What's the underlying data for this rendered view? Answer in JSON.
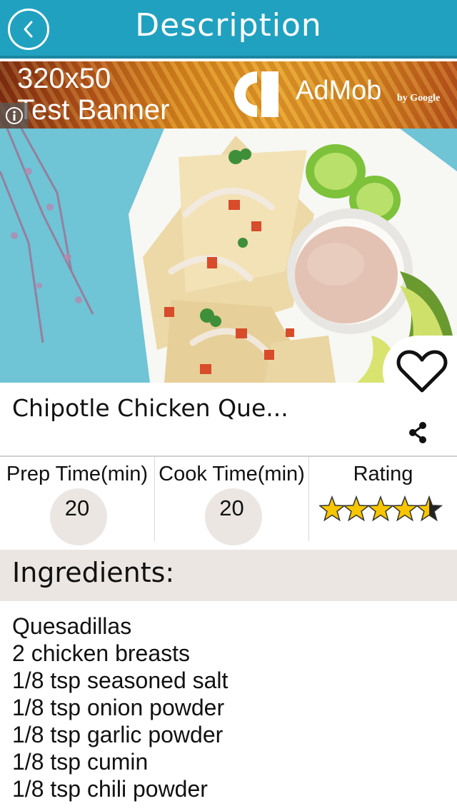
{
  "header": {
    "title": "Description",
    "back_icon": "chevron-left-icon",
    "background_color": "#21a1c0"
  },
  "ad": {
    "size_text": "320x50",
    "label": "Test Banner",
    "brand": "AdMob",
    "byline": "by Google",
    "info_icon": "info-icon"
  },
  "recipe": {
    "title": "Chipotle Chicken Que...",
    "favorite_icon": "heart-outline-icon",
    "share_icon": "share-icon"
  },
  "stats": {
    "prep_label": "Prep Time(min)",
    "prep_value": "20",
    "cook_label": "Cook Time(min)",
    "cook_value": "20",
    "rating_label": "Rating",
    "rating_value": 4.5,
    "rating_max": 5,
    "star_color": "#f7c600"
  },
  "ingredients": {
    "title": "Ingredients:",
    "items": [
      "Quesadillas",
      "2 chicken breasts",
      "1/8 tsp seasoned salt",
      "1/8 tsp onion powder",
      "1/8 tsp garlic powder",
      "1/8 tsp cumin",
      "1/8 tsp chili powder"
    ]
  }
}
